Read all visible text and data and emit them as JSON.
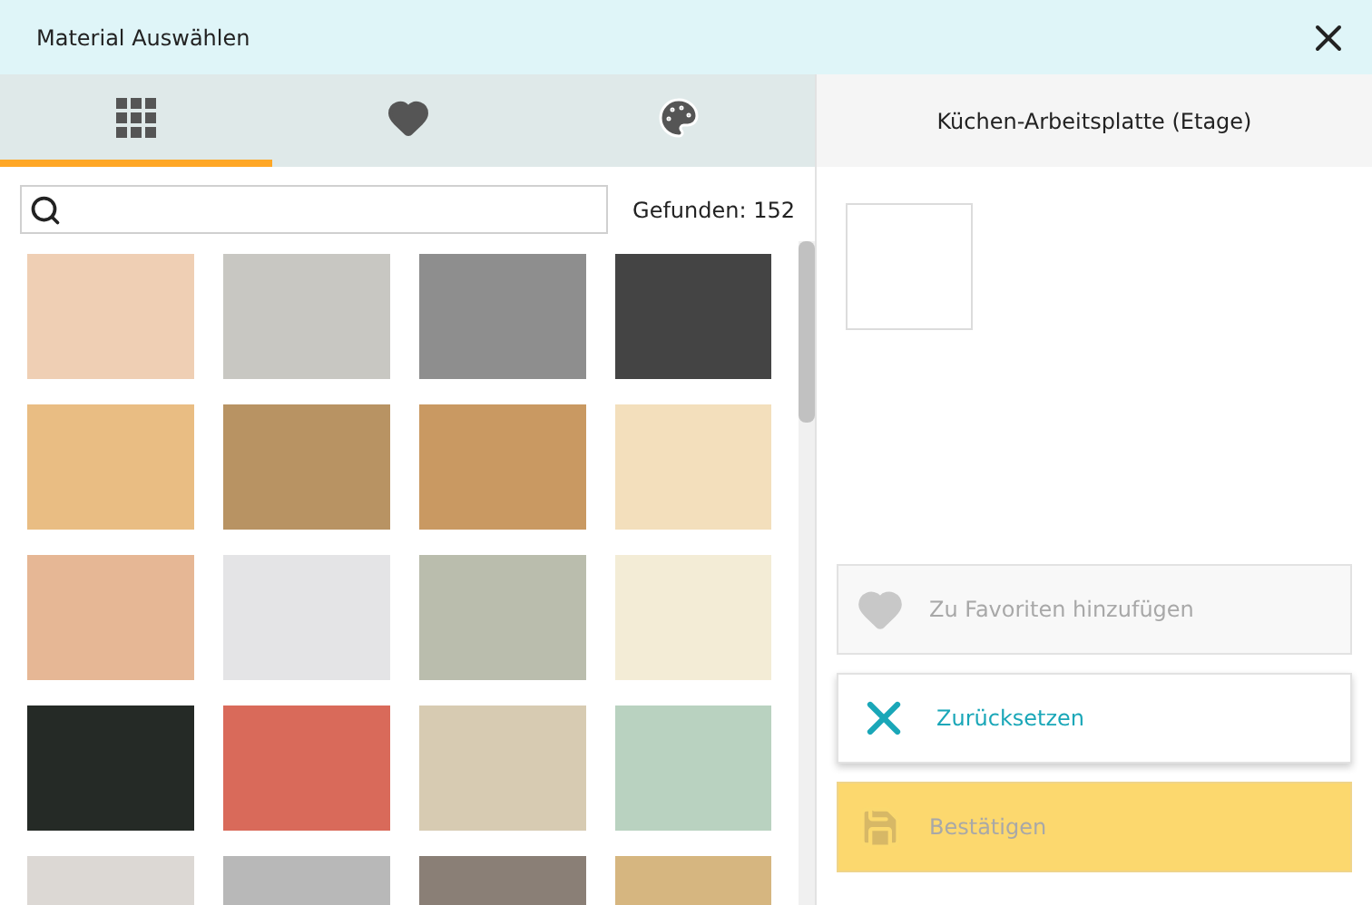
{
  "window": {
    "title": "Material Auswählen"
  },
  "tabs": [
    {
      "kind": "grid",
      "selected": true
    },
    {
      "kind": "heart",
      "selected": false
    },
    {
      "kind": "palette",
      "selected": false
    }
  ],
  "search": {
    "found": "Gefunden: 152"
  },
  "swatches": [
    {
      "color": "#efcfb4"
    },
    {
      "color": "#c8c7c2"
    },
    {
      "color": "#8e8e8e"
    },
    {
      "color": "#444444"
    },
    {
      "color": "#e9bd83"
    },
    {
      "color": "#b89363"
    },
    {
      "color": "#c99962"
    },
    {
      "color": "#f3dfbc"
    },
    {
      "color": "#e6b795"
    },
    {
      "color": "#e4e4e6"
    },
    {
      "color": "#babdad"
    },
    {
      "color": "#f3ecd6"
    },
    {
      "color": "#252a26"
    },
    {
      "color": "#d96a5a"
    },
    {
      "color": "#d7cbb2"
    },
    {
      "color": "#b9d2c0"
    },
    {
      "color": "#dcd8d4"
    },
    {
      "color": "#b8b8b8"
    },
    {
      "color": "#8a7f76"
    },
    {
      "color": "#d6b680"
    }
  ],
  "detail": {
    "title": "Küchen-Arbeitsplatte (Etage)"
  },
  "actions": [
    {
      "kind": "favorite",
      "label": "Zu Favoriten hinzufügen",
      "disabled": true
    },
    {
      "kind": "reset",
      "label": "Zurücksetzen",
      "disabled": false
    },
    {
      "kind": "confirm",
      "label": "Bestätigen",
      "disabled": true
    }
  ]
}
